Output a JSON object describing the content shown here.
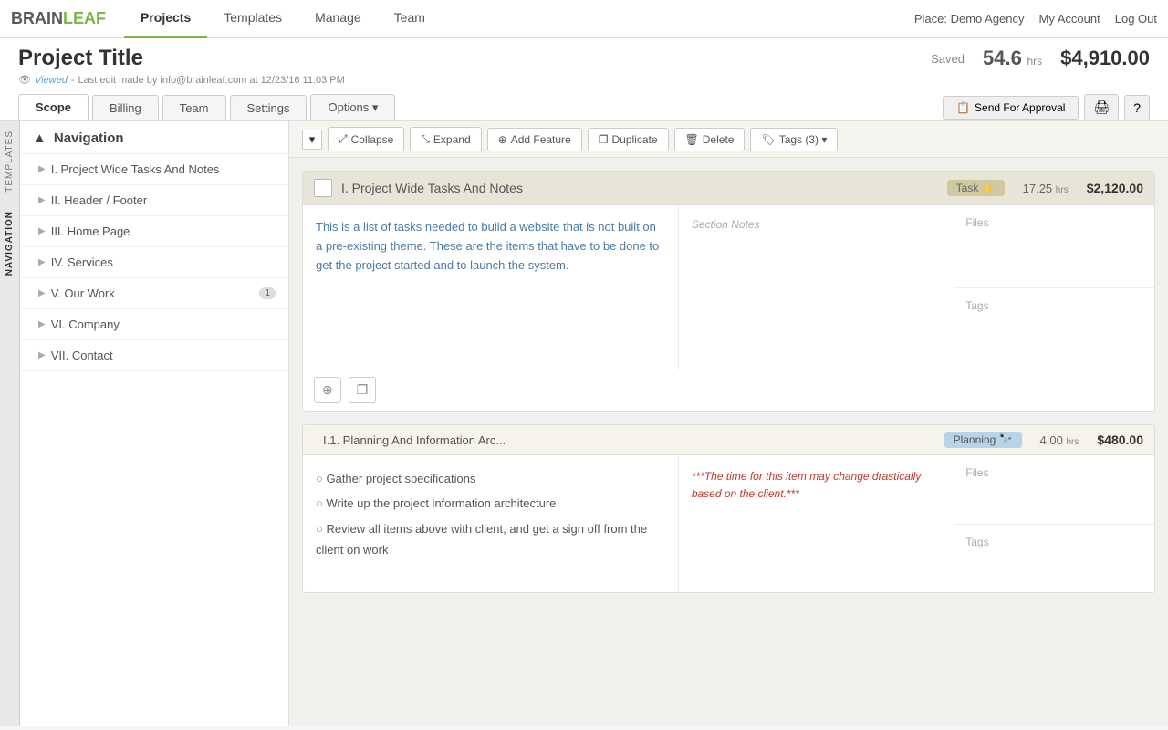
{
  "logo": {
    "brain": "BRAIN",
    "leaf": "LEAF"
  },
  "topNav": {
    "links": [
      {
        "label": "Projects",
        "active": true
      },
      {
        "label": "Templates",
        "active": false
      },
      {
        "label": "Manage",
        "active": false
      },
      {
        "label": "Team",
        "active": false
      }
    ],
    "right": {
      "place": "Place: Demo Agency",
      "account": "My Account",
      "logout": "Log Out"
    }
  },
  "project": {
    "title": "Project Title",
    "saved": "Saved",
    "hours": "54.6",
    "hrs_label": "hrs",
    "price": "$4,910.00",
    "meta_viewed": "Viewed",
    "meta_dash": "-",
    "meta_edit": "Last edit made by info@brainleaf.com at 12/23/16 11:03 PM"
  },
  "tabs": [
    {
      "label": "Scope",
      "active": true
    },
    {
      "label": "Billing",
      "active": false
    },
    {
      "label": "Team",
      "active": false
    },
    {
      "label": "Settings",
      "active": false
    },
    {
      "label": "Options ▾",
      "active": false
    }
  ],
  "sendApproval": "Send For Approval",
  "toolbar": {
    "collapse": "Collapse",
    "expand": "Expand",
    "addFeature": "Add Feature",
    "duplicate": "Duplicate",
    "delete": "Delete",
    "tags": "Tags (3) ▾"
  },
  "sidebar": {
    "header": "Navigation",
    "items": [
      {
        "label": "I. Project Wide Tasks And Notes",
        "roman": "I.",
        "name": "Project Wide Tasks And Notes",
        "count": ""
      },
      {
        "label": "II. Header / Footer",
        "roman": "II.",
        "name": "Header / Footer",
        "count": ""
      },
      {
        "label": "III. Home Page",
        "roman": "III.",
        "name": "Home Page",
        "count": ""
      },
      {
        "label": "IV. Services",
        "roman": "IV.",
        "name": "Services",
        "count": ""
      },
      {
        "label": "V. Our Work",
        "roman": "V.",
        "name": "Our Work",
        "count": "1"
      },
      {
        "label": "VI. Company",
        "roman": "VI.",
        "name": "Company",
        "count": ""
      },
      {
        "label": "VII. Contact",
        "roman": "VII.",
        "name": "Contact",
        "count": ""
      }
    ]
  },
  "vertLabels": [
    {
      "label": "Templates",
      "active": false
    },
    {
      "label": "Navigation",
      "active": true
    }
  ],
  "section1": {
    "title": "I. Project Wide Tasks And Notes",
    "badge": "Task ⚡",
    "hours": "17.25",
    "hrs_label": "hrs",
    "price": "$2,120.00",
    "description": "This is a list of tasks needed to build a website that is not built on a pre-existing theme. These are the items that have to be done to get the project started and to launch the system.",
    "notes_placeholder": "Section Notes",
    "files_placeholder": "Files",
    "tags_placeholder": "Tags"
  },
  "section2": {
    "title": "I.1. Planning And Information Arc...",
    "badge": "Planning 🔭",
    "hours": "4.00",
    "hrs_label": "hrs",
    "price": "$480.00",
    "tasks": [
      "Gather project specifications",
      "Write up the project information architecture",
      "Review all items above with client, and get a sign off from the client on work"
    ],
    "notes": "***The time for this item may change drastically based on the client.***",
    "files_placeholder": "Files",
    "tags_placeholder": "Tags"
  }
}
